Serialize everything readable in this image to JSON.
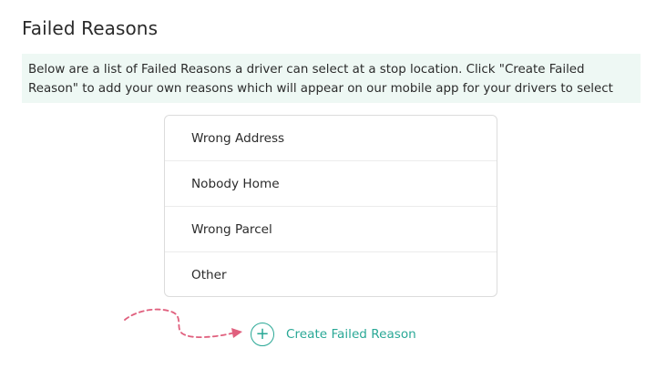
{
  "page": {
    "title": "Failed Reasons",
    "description": "Below are a list of Failed Reasons a driver can select at a stop location. Click \"Create Failed Reason\" to add your own reasons which will appear on our mobile app for your drivers to select"
  },
  "reasons": [
    {
      "label": "Wrong Address"
    },
    {
      "label": "Nobody Home"
    },
    {
      "label": "Wrong Parcel"
    },
    {
      "label": "Other"
    }
  ],
  "create_button": {
    "label": "Create Failed Reason",
    "icon": "plus-circle-icon"
  },
  "colors": {
    "accent": "#2aa896",
    "banner_bg": "#eef8f4",
    "arrow": "#e0607e"
  }
}
